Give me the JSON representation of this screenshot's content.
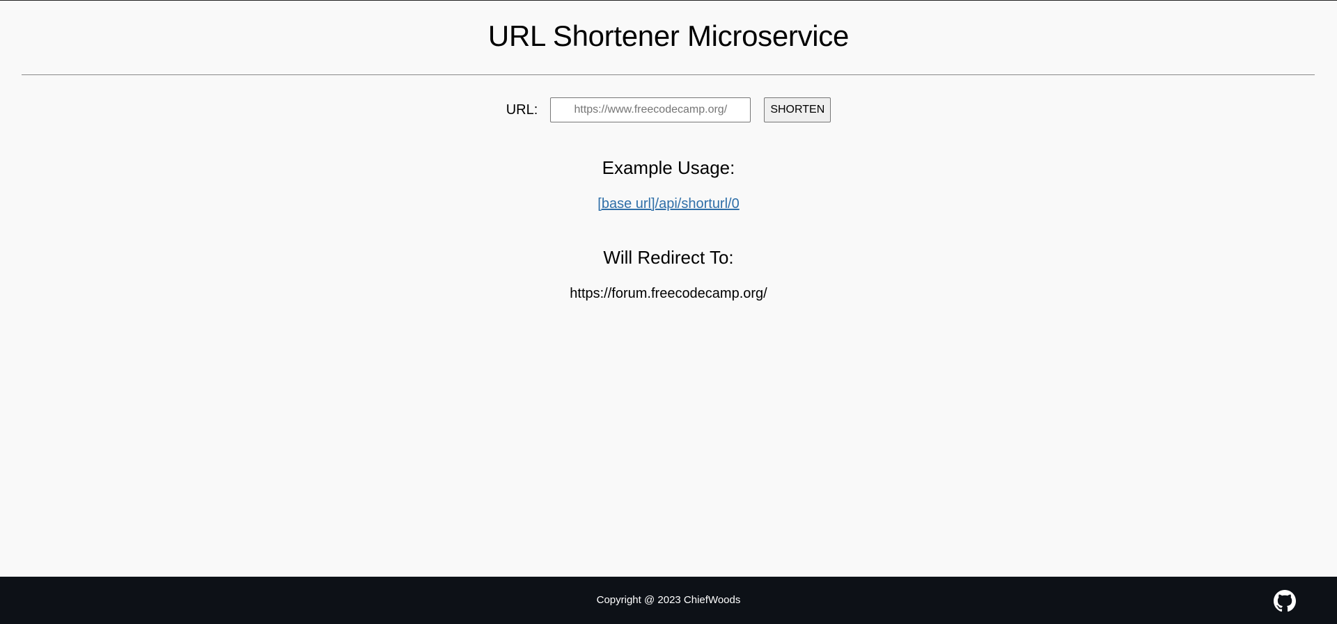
{
  "header": {
    "title": "URL Shortener Microservice"
  },
  "form": {
    "url_label": "URL:",
    "url_placeholder": "https://www.freecodecamp.org/",
    "url_value": "",
    "submit_label": "SHORTEN"
  },
  "example": {
    "heading": "Example Usage:",
    "link_text": "[base url]/api/shorturl/0"
  },
  "redirect": {
    "heading": "Will Redirect To:",
    "target": "https://forum.freecodecamp.org/"
  },
  "footer": {
    "copyright": "Copyright @ 2023 ChiefWoods",
    "github_icon": "github-icon"
  },
  "colors": {
    "background": "#f9f9f9",
    "footer_background": "#0d1117",
    "link": "#2f6fa8",
    "divider": "#8a8a8a"
  }
}
